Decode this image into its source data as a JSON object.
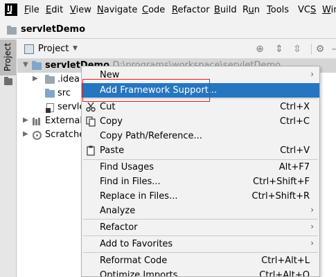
{
  "menubar": {
    "logo_text": "IJ",
    "items": [
      {
        "label": "File",
        "mnemonic": "F",
        "rest": "ile"
      },
      {
        "label": "Edit",
        "mnemonic": "E",
        "rest": "dit"
      },
      {
        "label": "View",
        "mnemonic": "V",
        "rest": "iew"
      },
      {
        "label": "Navigate",
        "mnemonic": "N",
        "rest": "avigate"
      },
      {
        "label": "Code",
        "mnemonic": "C",
        "rest": "ode"
      },
      {
        "label": "Refactor",
        "mnemonic": "R",
        "rest": "efactor"
      },
      {
        "label": "Build",
        "mnemonic": "B",
        "rest": "uild"
      },
      {
        "label": "Run",
        "mnemonic": "u",
        "pre": "R",
        "rest": "n"
      },
      {
        "label": "Tools",
        "mnemonic": "T",
        "rest": "ools"
      },
      {
        "label": "VCS",
        "mnemonic": "S",
        "pre": "VC",
        "rest": ""
      },
      {
        "label": "Win",
        "mnemonic": "W",
        "rest": "in"
      }
    ]
  },
  "navbar": {
    "title": "servletDemo"
  },
  "toolstrip": {
    "project_tab": "Project"
  },
  "panel": {
    "view_label": "Project",
    "dropdown_icon": "caret-down-icon"
  },
  "tree": {
    "root": {
      "name": "servletDemo",
      "path": "D:\\programs\\workspace\\servletDemo"
    },
    "items": [
      {
        "name": ".idea"
      },
      {
        "name": "src"
      },
      {
        "name": "servlet"
      },
      {
        "name": "External L"
      },
      {
        "name": "Scratches"
      }
    ]
  },
  "context_menu": {
    "items": [
      {
        "label": "New",
        "submenu": true
      },
      {
        "label": "Add Framework Support...",
        "highlighted": true
      },
      {
        "label": "Cut",
        "shortcut": "Ctrl+X",
        "icon": "scissors-icon"
      },
      {
        "label": "Copy",
        "shortcut": "Ctrl+C",
        "icon": "copy-icon"
      },
      {
        "label": "Copy Path/Reference..."
      },
      {
        "label": "Paste",
        "shortcut": "Ctrl+V",
        "icon": "paste-icon"
      },
      {
        "label": "Find Usages",
        "shortcut": "Alt+F7"
      },
      {
        "label": "Find in Files...",
        "shortcut": "Ctrl+Shift+F"
      },
      {
        "label": "Replace in Files...",
        "shortcut": "Ctrl+Shift+R"
      },
      {
        "label": "Analyze",
        "submenu": true
      },
      {
        "label": "Refactor",
        "submenu": true
      },
      {
        "label": "Add to Favorites",
        "submenu": true
      },
      {
        "label": "Reformat Code",
        "shortcut": "Ctrl+Alt+L"
      },
      {
        "label": "Optimize Imports",
        "shortcut": "Ctrl+Alt+O"
      }
    ]
  },
  "colors": {
    "accent": "#2675bf",
    "annotation": "#e02020"
  }
}
